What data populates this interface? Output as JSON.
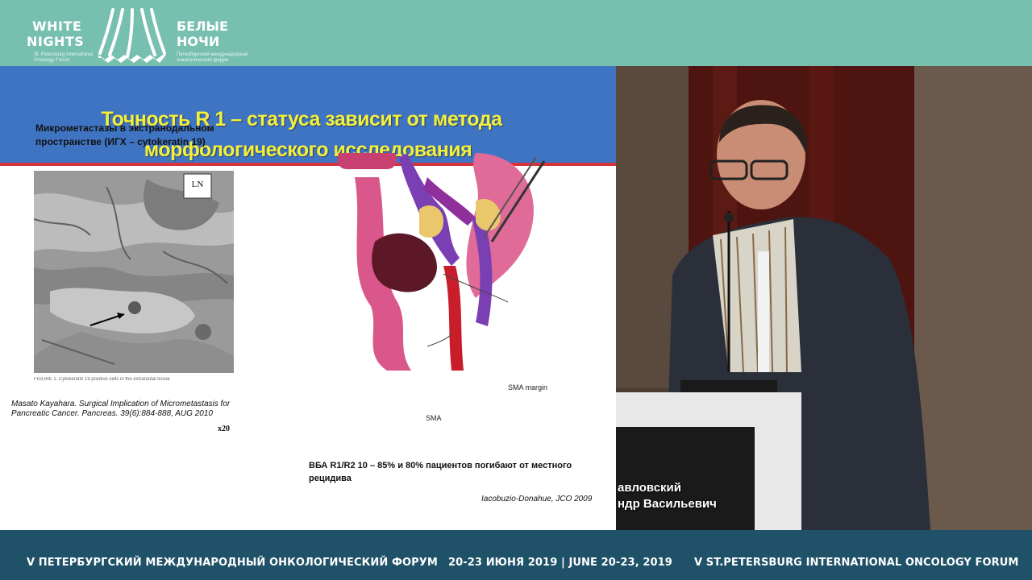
{
  "header": {
    "logo_left_line1": "WHITE",
    "logo_left_line2": "NIGHTS",
    "logo_left_sub": "St. Petersburg International Oncology Forum",
    "logo_right_line1": "БЕЛЫЕ",
    "logo_right_line2": "НОЧИ",
    "logo_right_sub": "Петербургский международный онкологический форум"
  },
  "slide": {
    "title_line1": "Точность R 1 – статуса  зависит от метода",
    "title_line2": "морфологического исследования",
    "caption_left": "Микрометастазы в экстранодальном пространстве (ИГХ – cytokeratin 19)",
    "photo_label_ln": "LN",
    "photo_label_zoom": "x20",
    "photo_caption_strip": "FIGURE 1. Cytokeratin 19 positive cells in the extranodal tissue",
    "reference_left": "Masato Kayahara. Surgical Implication of Micrometastasis for Pancreatic Cancer. Pancreas. 39(6):884-888, AUG 2010",
    "label_sma_margin": "SMA margin",
    "label_sma": "SMA",
    "stat_text": "ВБА R1/R2 10 – 85% и 80% пациентов погибают от местного рецидива",
    "reference_right": "Iacobuzio-Donahue, JCO 2009"
  },
  "speaker": {
    "line1": "авловский",
    "line2": "ндр Васильевич"
  },
  "footer": {
    "forum_ru": "V ПЕТЕРБУРГСКИЙ МЕЖДУНАРОДНЫЙ ОНКОЛОГИЧЕСКИЙ ФОРУМ",
    "dates": "20-23 ИЮНЯ 2019 | JUNE 20-23, 2019",
    "forum_en": "V ST.PETERSBURG INTERNATIONAL ONCOLOGY FORUM"
  },
  "colors": {
    "banner": "#77bfae",
    "slide_header": "#3f74c2",
    "title_yellow": "#f4f03a",
    "accent_red": "#d7333a",
    "footer": "#1f5168"
  }
}
